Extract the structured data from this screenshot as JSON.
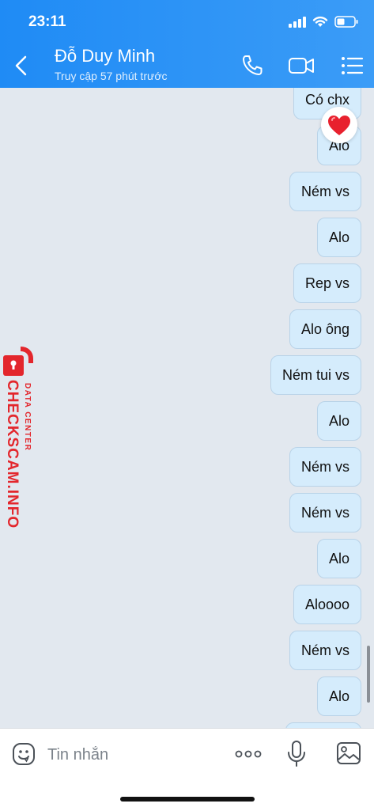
{
  "status_bar": {
    "time": "23:11"
  },
  "header": {
    "contact_name": "Đỗ Duy Minh",
    "last_seen": "Truy cập 57 phút trước",
    "icons": [
      "back-icon",
      "phone-icon",
      "video-call-icon",
      "menu-icon"
    ]
  },
  "messages": [
    {
      "text": "Có chx",
      "reaction": "heart-icon"
    },
    {
      "text": "Alo"
    },
    {
      "text": "Ném vs"
    },
    {
      "text": "Alo"
    },
    {
      "text": "Rep vs"
    },
    {
      "text": "Alo ông"
    },
    {
      "text": "Ném tui vs"
    },
    {
      "text": "Alo"
    },
    {
      "text": "Ném vs"
    },
    {
      "text": "Ném vs"
    },
    {
      "text": "Alo"
    },
    {
      "text": "Aloooo"
    },
    {
      "text": "Ném vs"
    },
    {
      "text": "Alo"
    },
    {
      "text": ""
    }
  ],
  "watermark": {
    "brand": "CHECKSCAM.INFO",
    "sub": "DATA CENTER"
  },
  "composer": {
    "placeholder": "Tin nhắn",
    "icons": [
      "emoji-icon",
      "more-icon",
      "microphone-icon",
      "image-icon"
    ]
  },
  "colors": {
    "header": "#1f8bf5",
    "bubble": "#d5ecfc",
    "watermark": "#e3262c"
  }
}
